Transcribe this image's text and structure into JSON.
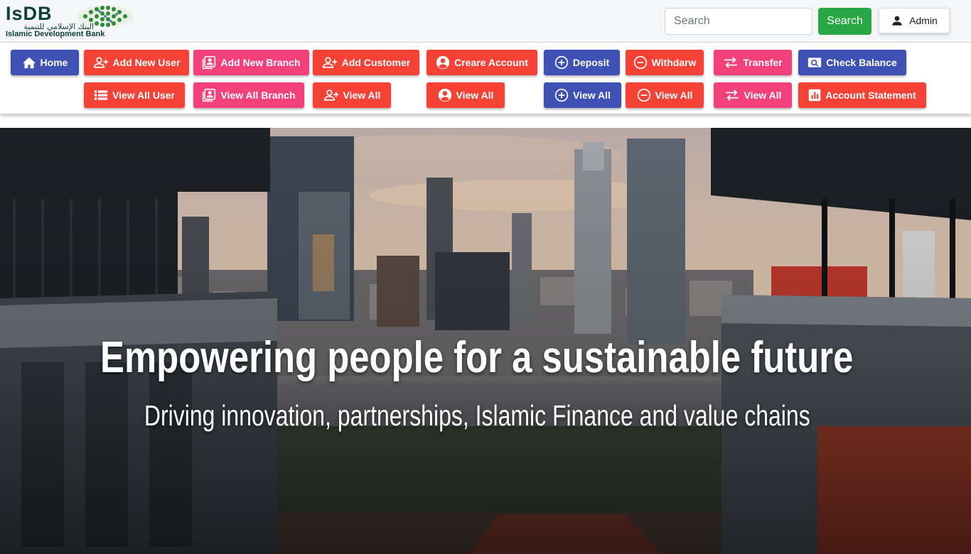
{
  "header": {
    "logo": {
      "latin": "IsDB",
      "arabic": "البنك الإسلامي للتنمية",
      "english": "Islamic Development Bank"
    },
    "search": {
      "placeholder": "Search",
      "value": ""
    },
    "search_button": "Search",
    "admin_button": {
      "label": "Admin",
      "icon": "person-icon"
    }
  },
  "nav": {
    "home": {
      "label": "Home",
      "icon": "home-icon",
      "color": "#3f51b5"
    },
    "add_user": {
      "label": "Add New User",
      "icon": "person-add-icon",
      "color": "#f44336"
    },
    "add_branch": {
      "label": "Add New Branch",
      "icon": "contact-card-icon",
      "color": "#f2407a"
    },
    "add_customer": {
      "label": "Add Customer",
      "icon": "person-add-icon",
      "color": "#f44336"
    },
    "create_account": {
      "label": "Creare Account",
      "icon": "account-circle-icon",
      "color": "#f44336"
    },
    "deposit": {
      "label": "Deposit",
      "icon": "plus-circle-icon",
      "color": "#3f51b5"
    },
    "withdraw": {
      "label": "Withdarw",
      "icon": "minus-circle-icon",
      "color": "#f44336"
    },
    "transfer": {
      "label": "Transfer",
      "icon": "swap-arrows-icon",
      "color": "#f2407a"
    },
    "check_balance": {
      "label": "Check Balance",
      "icon": "balance-search-icon",
      "color": "#3f51b5"
    },
    "view_all_user": {
      "label": "View All User",
      "icon": "list-icon",
      "color": "#f44336"
    },
    "view_all_branch": {
      "label": "View All Branch",
      "icon": "contact-card-icon",
      "color": "#f2407a"
    },
    "view_all_customer": {
      "label": "View All",
      "icon": "person-add-icon",
      "color": "#f44336"
    },
    "view_all_account": {
      "label": "View All",
      "icon": "account-circle-icon",
      "color": "#f44336"
    },
    "view_all_deposit": {
      "label": "View All",
      "icon": "plus-circle-icon",
      "color": "#3f51b5"
    },
    "view_all_withdraw": {
      "label": "View All",
      "icon": "minus-circle-icon",
      "color": "#f44336"
    },
    "view_all_transfer": {
      "label": "View All",
      "icon": "swap-arrows-icon",
      "color": "#f2407a"
    },
    "account_statement": {
      "label": "Account Statement",
      "icon": "bar-chart-icon",
      "color": "#f44336"
    }
  },
  "hero": {
    "title": "Empowering people for a sustainable future",
    "subtitle": "Driving innovation, partnerships, Islamic Finance and value chains"
  }
}
